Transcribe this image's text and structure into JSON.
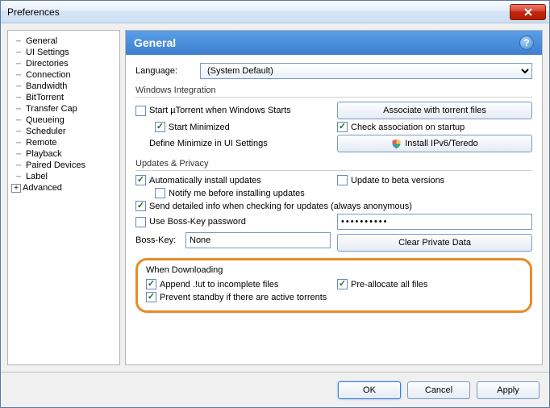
{
  "titlebar": {
    "title": "Preferences"
  },
  "sidebar": {
    "items": [
      {
        "label": "General"
      },
      {
        "label": "UI Settings"
      },
      {
        "label": "Directories"
      },
      {
        "label": "Connection"
      },
      {
        "label": "Bandwidth"
      },
      {
        "label": "BitTorrent"
      },
      {
        "label": "Transfer Cap"
      },
      {
        "label": "Queueing"
      },
      {
        "label": "Scheduler"
      },
      {
        "label": "Remote"
      },
      {
        "label": "Playback"
      },
      {
        "label": "Paired Devices"
      },
      {
        "label": "Label"
      },
      {
        "label": "Advanced"
      }
    ]
  },
  "header": {
    "title": "General",
    "help": "?"
  },
  "language": {
    "label": "Language:",
    "value": "(System Default)"
  },
  "sections": {
    "win_integration": "Windows Integration",
    "updates_privacy": "Updates & Privacy",
    "when_downloading": "When Downloading"
  },
  "checks": {
    "start_windows": "Start µTorrent when Windows Starts",
    "start_minimized": "Start Minimized",
    "define_minimize": "Define Minimize in UI Settings",
    "check_assoc": "Check association on startup",
    "auto_updates": "Automatically install updates",
    "beta": "Update to beta versions",
    "notify_updates": "Notify me before installing updates",
    "send_detailed": "Send detailed info when checking for updates (always anonymous)",
    "boss_key": "Use Boss-Key password",
    "append_ut": "Append .!ut to incomplete files",
    "prealloc": "Pre-allocate all files",
    "prevent_standby": "Prevent standby if there are active torrents"
  },
  "buttons": {
    "associate": "Associate with torrent files",
    "ipv6": "Install IPv6/Teredo",
    "clear_private": "Clear Private Data",
    "ok": "OK",
    "cancel": "Cancel",
    "apply": "Apply"
  },
  "bosskey": {
    "label": "Boss-Key:",
    "value": "None",
    "password": "••••••••••"
  }
}
